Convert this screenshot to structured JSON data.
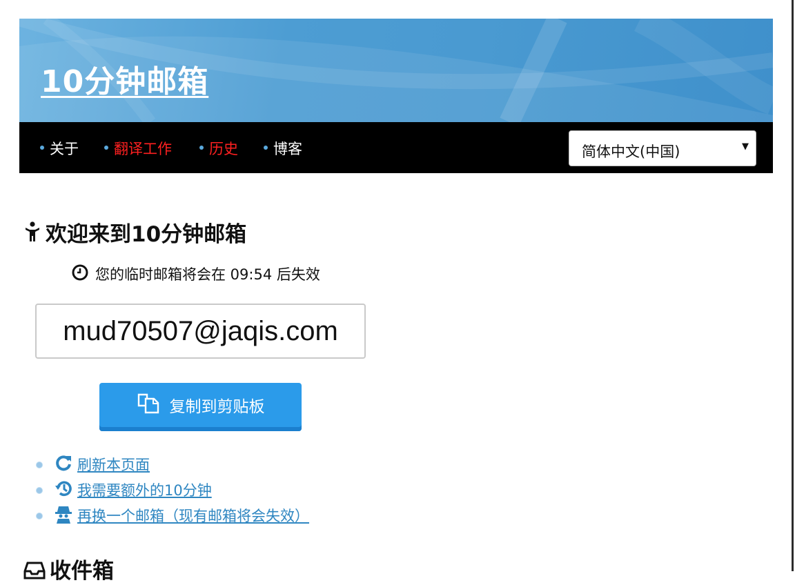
{
  "site": {
    "title": "10分钟邮箱"
  },
  "nav": {
    "items": [
      {
        "label": "关于"
      },
      {
        "label": "翻译工作"
      },
      {
        "label": "历史"
      },
      {
        "label": "博客"
      }
    ],
    "language": {
      "selected": "简体中文(中国)",
      "arrow": "▼"
    }
  },
  "main": {
    "welcome_heading": "欢迎来到10分钟邮箱",
    "timer_text": "您的临时邮箱将会在 09:54 后失效",
    "email_address": "mud70507@jaqis.com",
    "copy_button_label": "复制到剪贴板",
    "actions": [
      {
        "label": " 刷新本页面",
        "icon": "refresh-icon"
      },
      {
        "label": " 我需要额外的10分钟",
        "icon": "history-icon"
      },
      {
        "label": " 再换一个邮箱（现有邮箱将会失效）",
        "icon": "spy-icon"
      }
    ],
    "inbox_heading": "收件箱"
  },
  "colors": {
    "banner": "#4a9ad1",
    "navbar": "#000000",
    "nav_highlight": "#ff2020",
    "button": "#2b9bea",
    "link": "#2e86c1"
  }
}
